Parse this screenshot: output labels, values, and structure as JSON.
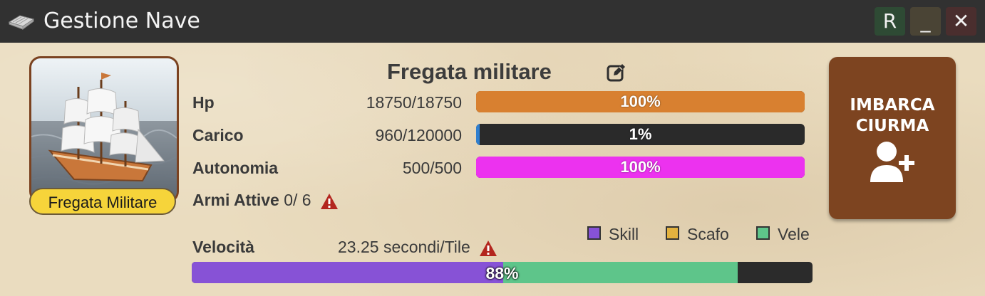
{
  "window": {
    "title": "Gestione Nave",
    "icon": "book-icon"
  },
  "titlebar_buttons": {
    "refresh": "R",
    "minimize": "_",
    "close": "✕"
  },
  "ship": {
    "name": "Fregata militare",
    "type_label": "Fregata Militare",
    "edit_icon": "edit-icon"
  },
  "stats": [
    {
      "label": "Hp",
      "value": "18750/18750",
      "percent_text": "100%",
      "percent": 100,
      "color": "#d88030"
    },
    {
      "label": "Carico",
      "value": "960/120000",
      "percent_text": "1%",
      "percent": 1,
      "color": "#2f7fcf"
    },
    {
      "label": "Autonomia",
      "value": "500/500",
      "percent_text": "100%",
      "percent": 100,
      "color": "#ec32ef"
    }
  ],
  "weapons": {
    "label": "Armi Attive",
    "value": "0/ 6",
    "warning_icon": "warning-icon"
  },
  "legend": [
    {
      "name": "Skill",
      "color": "#8752d6"
    },
    {
      "name": "Scafo",
      "color": "#e3b23f"
    },
    {
      "name": "Vele",
      "color": "#5ec58a"
    }
  ],
  "speed": {
    "label": "Velocità",
    "value": "23.25 secondi/Tile",
    "percent_text": "88%",
    "segments": [
      {
        "name": "Skill",
        "percent": 50.2,
        "color": "#8752d6"
      },
      {
        "name": "Vele",
        "percent": 37.8,
        "color": "#5ec58a"
      }
    ]
  },
  "embark_button": {
    "line1": "IMBARCA",
    "line2": "CIURMA",
    "icon": "add-user-icon"
  }
}
